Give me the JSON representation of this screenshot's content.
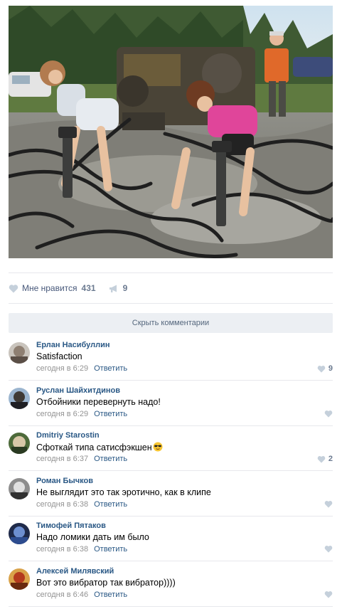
{
  "post": {
    "photo_alt": "",
    "likes_label": "Мне нравится",
    "likes_count": "431",
    "reposts_count": "9"
  },
  "comments_toggle_label": "Скрыть комментарии",
  "comments": [
    {
      "author": "Ерлан Насибуллин",
      "text": "Satisfaction",
      "time": "сегодня в 6:29",
      "reply": "Ответить",
      "likes": "9"
    },
    {
      "author": "Руслан Шайхитдинов",
      "text": "Отбойники перевернуть надо!",
      "time": "сегодня в 6:29",
      "reply": "Ответить",
      "likes": ""
    },
    {
      "author": "Dmitriy Starostin",
      "text": "Сфоткай типа сатисфэкшен",
      "time": "сегодня в 6:37",
      "reply": "Ответить",
      "likes": "2"
    },
    {
      "author": "Роман Бычков",
      "text": "Не выглядит это так эротично, как в клипе",
      "time": "сегодня в 6:38",
      "reply": "Ответить",
      "likes": ""
    },
    {
      "author": "Тимофей Пятаков",
      "text": "Надо ломики дать им было",
      "time": "сегодня в 6:38",
      "reply": "Ответить",
      "likes": ""
    },
    {
      "author": "Алексей Милявский",
      "text": "Вот это вибратор так вибратор))))",
      "time": "сегодня в 6:46",
      "reply": "Ответить",
      "likes": ""
    }
  ],
  "colors": {
    "link": "#2a5885",
    "meta": "#939393",
    "toggle_bg": "#eceff3",
    "separator": "#e7e8ec"
  },
  "icons": {
    "like": "heart-icon",
    "repost": "megaphone-icon",
    "emoji": "sunglasses-emoji-icon"
  }
}
